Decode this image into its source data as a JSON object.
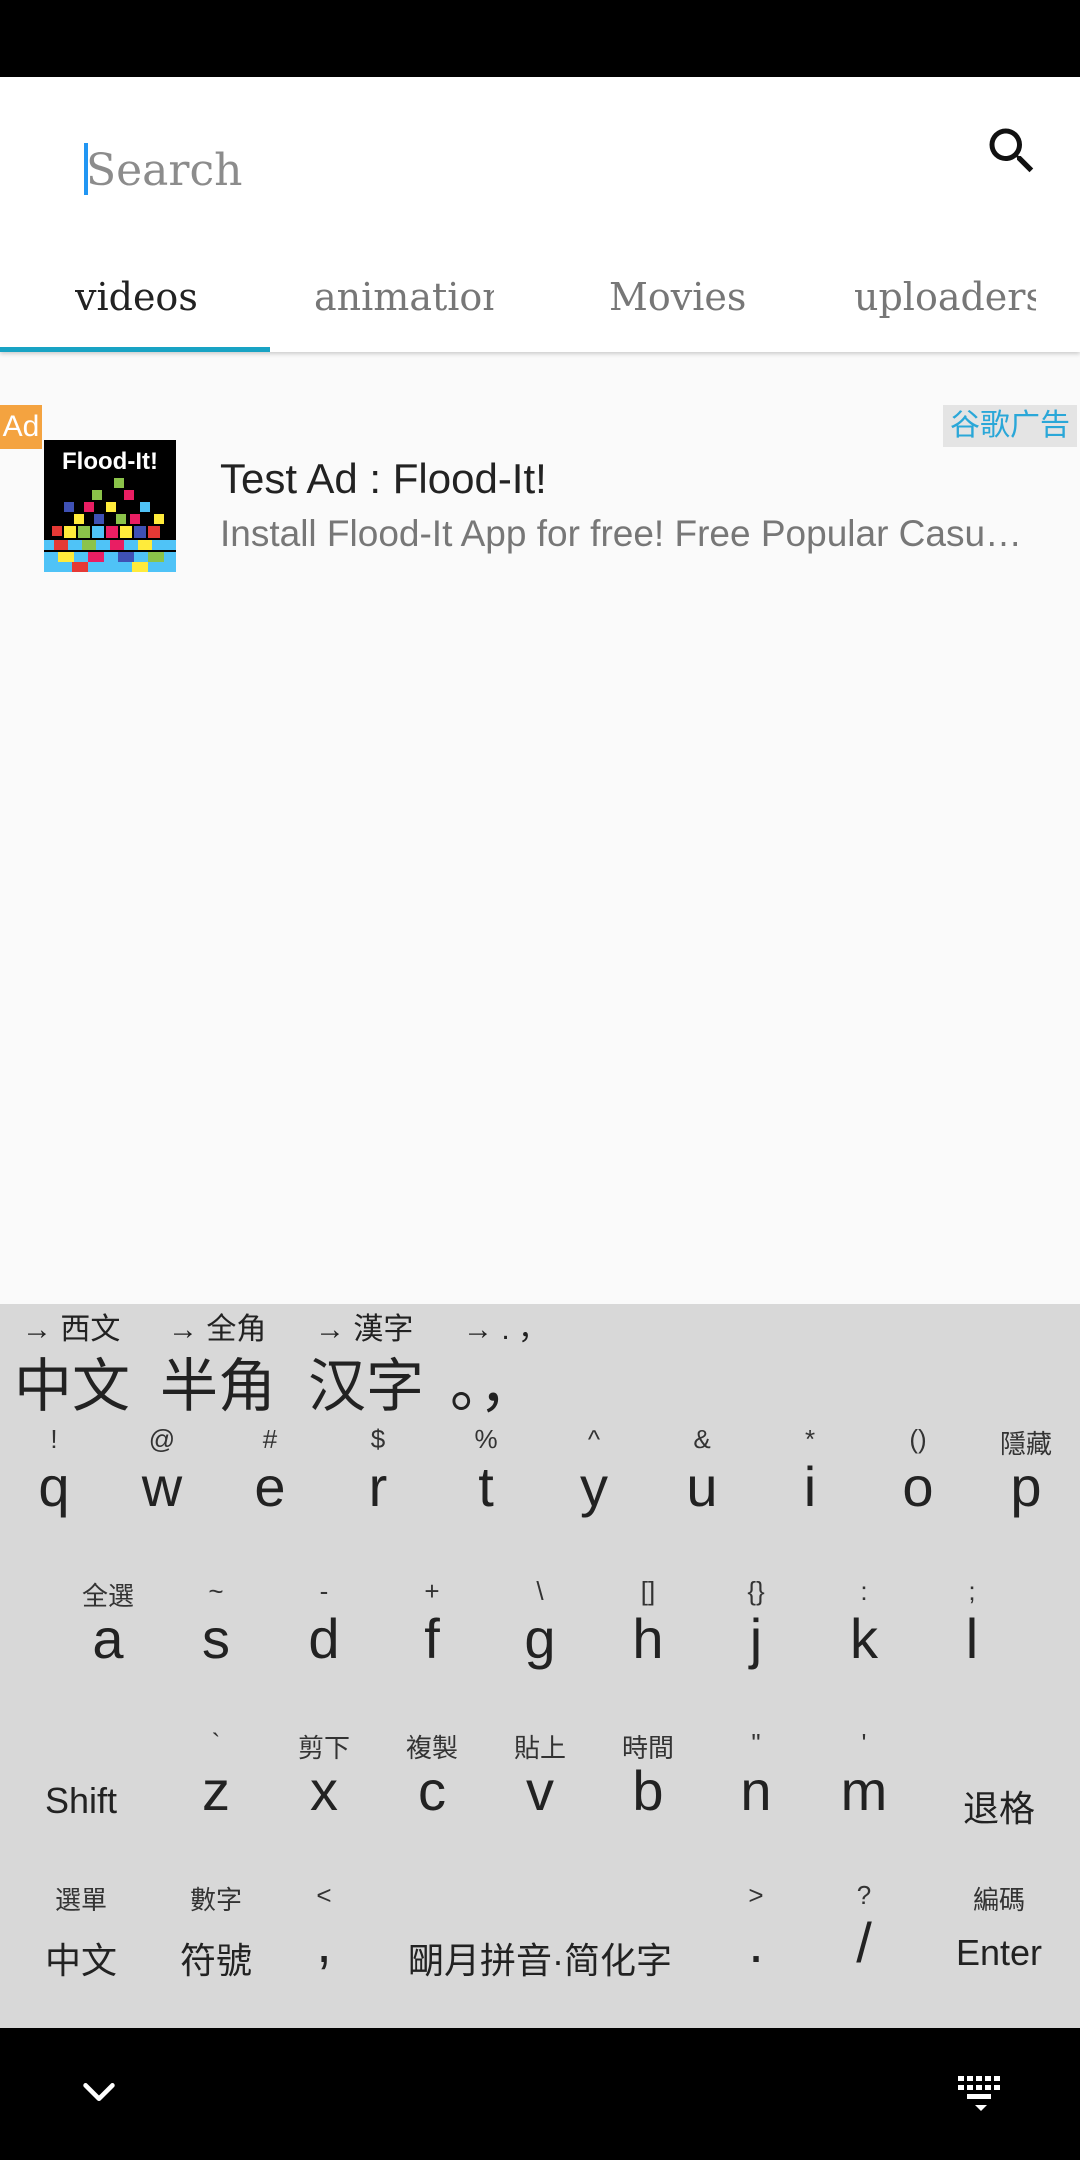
{
  "search": {
    "placeholder": "Search"
  },
  "tabs": [
    {
      "label": "videos",
      "active": true
    },
    {
      "label": "animation",
      "active": false
    },
    {
      "label": "Movies",
      "active": false
    },
    {
      "label": "uploaders",
      "active": false
    }
  ],
  "ad": {
    "badge": "Ad",
    "provider": "谷歌广告",
    "thumb_title": "Flood-It!",
    "title": "Test Ad : Flood-It!",
    "description": "Install Flood-It App for free! Free Popular Casual Game"
  },
  "keyboard": {
    "candidates": [
      {
        "hint": "→ 西文",
        "text": "中文"
      },
      {
        "hint": "→ 全角",
        "text": "半角"
      },
      {
        "hint": "→ 漢字",
        "text": "汉字"
      },
      {
        "hint": "→ . ，",
        "text": "。，"
      }
    ],
    "rows": [
      [
        {
          "hint": "!",
          "main": "q"
        },
        {
          "hint": "@",
          "main": "w"
        },
        {
          "hint": "#",
          "main": "e"
        },
        {
          "hint": "$",
          "main": "r"
        },
        {
          "hint": "%",
          "main": "t"
        },
        {
          "hint": "^",
          "main": "y"
        },
        {
          "hint": "&",
          "main": "u"
        },
        {
          "hint": "*",
          "main": "i"
        },
        {
          "hint": "()",
          "main": "o"
        },
        {
          "hint": "隱藏",
          "main": "p"
        }
      ],
      [
        {
          "hint": "全選",
          "main": "a"
        },
        {
          "hint": "~",
          "main": "s"
        },
        {
          "hint": "-",
          "main": "d"
        },
        {
          "hint": "+",
          "main": "f"
        },
        {
          "hint": "\\",
          "main": "g"
        },
        {
          "hint": "[]",
          "main": "h"
        },
        {
          "hint": "{}",
          "main": "j"
        },
        {
          "hint": ":",
          "main": "k"
        },
        {
          "hint": ";",
          "main": "l"
        }
      ],
      [
        {
          "hint": "",
          "main": "Shift"
        },
        {
          "hint": "`",
          "main": "z"
        },
        {
          "hint": "剪下",
          "main": "x"
        },
        {
          "hint": "複製",
          "main": "c"
        },
        {
          "hint": "貼上",
          "main": "v"
        },
        {
          "hint": "時間",
          "main": "b"
        },
        {
          "hint": "\"",
          "main": "n"
        },
        {
          "hint": "'",
          "main": "m"
        },
        {
          "hint": "",
          "main": "退格"
        }
      ],
      [
        {
          "hint": "選單",
          "main": "中文"
        },
        {
          "hint": "數字",
          "main": "符號"
        },
        {
          "hint": "<",
          "main": ","
        },
        {
          "hint": "",
          "main": "朙月拼音·简化字"
        },
        {
          "hint": ">",
          "main": "."
        },
        {
          "hint": "?",
          "main": "/"
        },
        {
          "hint": "編碼",
          "main": "Enter"
        }
      ]
    ]
  },
  "icons": {
    "search": "search-icon",
    "nav_back": "chevron-down-icon",
    "nav_keyboard": "keyboard-icon"
  },
  "colors": {
    "accent": "#18a3c4",
    "ad_badge": "#f4a340",
    "ad_provider_text": "#2aa7d8",
    "keyboard_bg": "#d8d8d8"
  }
}
